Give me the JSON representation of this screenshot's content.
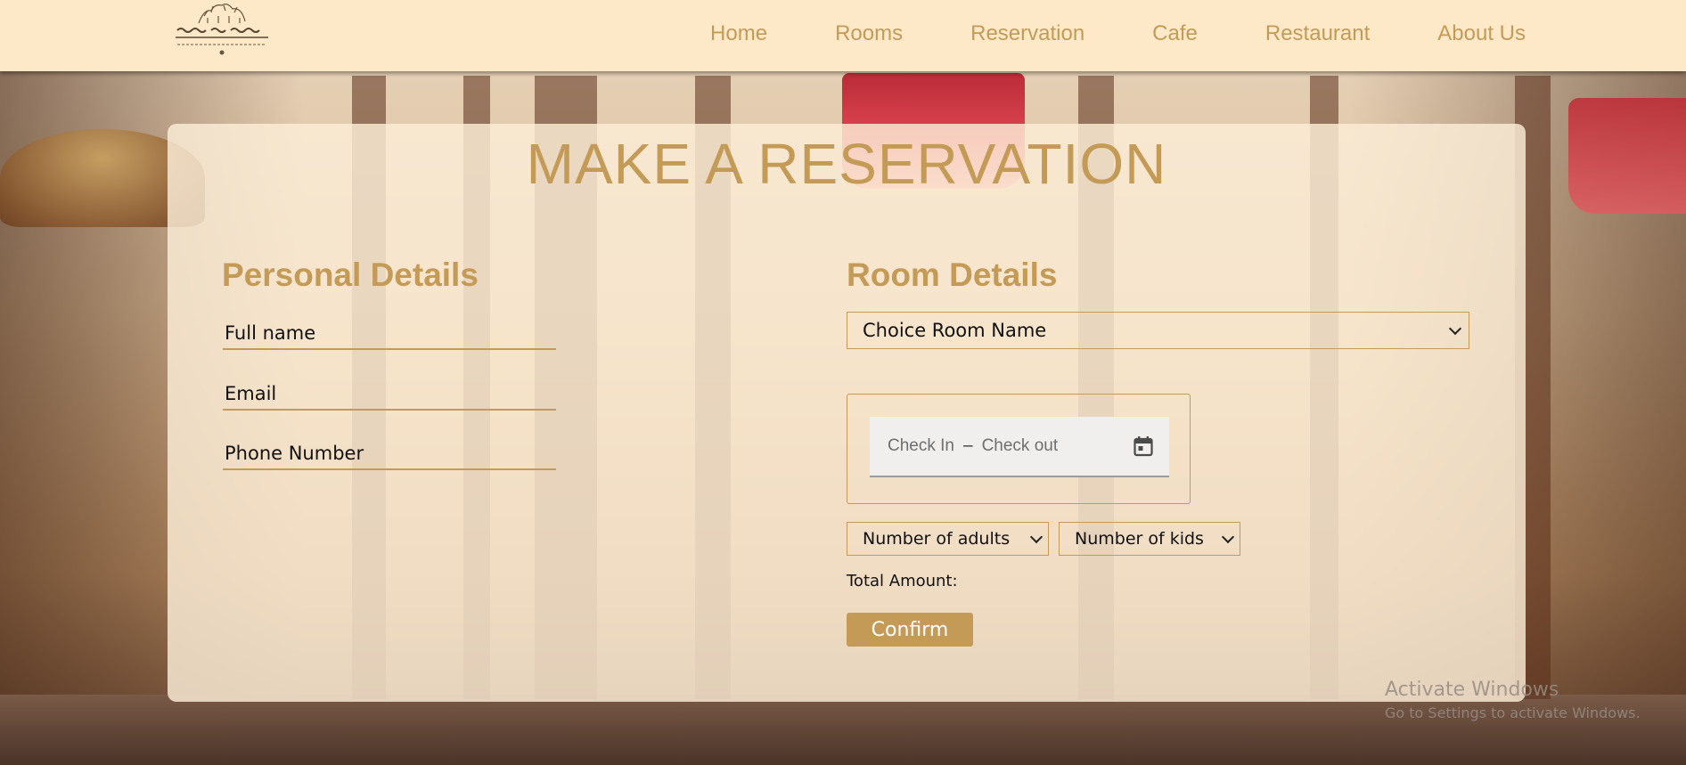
{
  "nav": {
    "logo_icon": "hotel-crest-logo",
    "items": [
      {
        "label": "Home"
      },
      {
        "label": "Rooms"
      },
      {
        "label": "Reservation"
      },
      {
        "label": "Cafe"
      },
      {
        "label": "Restaurant"
      },
      {
        "label": "About Us"
      }
    ]
  },
  "page": {
    "title": "MAKE A RESERVATION"
  },
  "personal": {
    "heading": "Personal Details",
    "full_name_placeholder": "Full name",
    "email_placeholder": "Email",
    "phone_placeholder": "Phone Number"
  },
  "room": {
    "heading": "Room Details",
    "room_select": "Choice Room Name",
    "check_in": "Check In",
    "dash": "–",
    "check_out": "Check out",
    "calendar_icon": "calendar-icon",
    "adults_select": "Number of adults",
    "kids_select": "Number of kids",
    "total_label": "Total Amount:",
    "confirm_label": "Confirm"
  },
  "os_overlay": {
    "title": "Activate Windows",
    "subtitle": "Go to Settings to activate Windows."
  },
  "colors": {
    "accent": "#c49a57",
    "navbar_bg": "#fde9c8",
    "panel_bg": "rgba(253,238,216,0.82)"
  }
}
